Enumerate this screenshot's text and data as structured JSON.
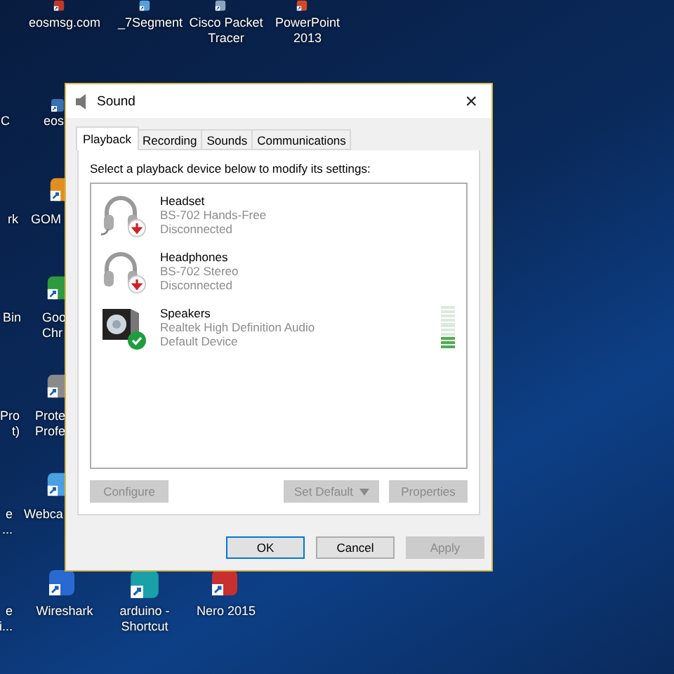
{
  "desktop_icons": [
    {
      "lines": [
        "eosmsg.com"
      ]
    },
    {
      "lines": [
        "_7Segment"
      ]
    },
    {
      "lines": [
        "Cisco Packet",
        "Tracer"
      ]
    },
    {
      "lines": [
        "PowerPoint",
        "2013"
      ]
    },
    {
      "lines": [
        "C"
      ]
    },
    {
      "lines": [
        "eos"
      ]
    },
    {
      "lines": [
        "rk"
      ]
    },
    {
      "lines": [
        "GOM"
      ]
    },
    {
      "lines": [
        "Bin"
      ]
    },
    {
      "lines": [
        "Goo",
        "Chr"
      ]
    },
    {
      "lines": [
        "Pro",
        "t)"
      ]
    },
    {
      "lines": [
        "Prote",
        "Profe"
      ]
    },
    {
      "lines": [
        "e",
        "..."
      ]
    },
    {
      "lines": [
        "Webca"
      ]
    },
    {
      "lines": [
        "e",
        "i..."
      ]
    },
    {
      "lines": [
        "Wireshark"
      ]
    },
    {
      "lines": [
        "arduino -",
        "Shortcut"
      ]
    },
    {
      "lines": [
        "Nero 2015"
      ]
    }
  ],
  "window": {
    "title": "Sound",
    "close": "×"
  },
  "tabs": [
    {
      "label": "Playback",
      "selected": true
    },
    {
      "label": "Recording",
      "selected": false
    },
    {
      "label": "Sounds",
      "selected": false
    },
    {
      "label": "Communications",
      "selected": false
    }
  ],
  "instruction": "Select a playback device below to modify its settings:",
  "devices": [
    {
      "kind": "headset",
      "name": "Headset",
      "detail": "BS-702 Hands-Free",
      "status": "Disconnected",
      "disconnected": true,
      "default": false
    },
    {
      "kind": "headphones",
      "name": "Headphones",
      "detail": "BS-702 Stereo",
      "status": "Disconnected",
      "disconnected": true,
      "default": false
    },
    {
      "kind": "speaker",
      "name": "Speakers",
      "detail": "Realtek High Definition Audio",
      "status": "Default Device",
      "disconnected": false,
      "default": true,
      "level": 0.3
    }
  ],
  "device_buttons": [
    {
      "label": "Configure",
      "disabled": true,
      "dropdown": false
    },
    {
      "label": "Set Default",
      "disabled": true,
      "dropdown": true
    },
    {
      "label": "Properties",
      "disabled": true,
      "dropdown": false
    }
  ],
  "dialog_buttons": [
    {
      "label": "OK",
      "disabled": false,
      "default": true
    },
    {
      "label": "Cancel",
      "disabled": false,
      "default": false
    },
    {
      "label": "Apply",
      "disabled": true,
      "default": false
    }
  ]
}
